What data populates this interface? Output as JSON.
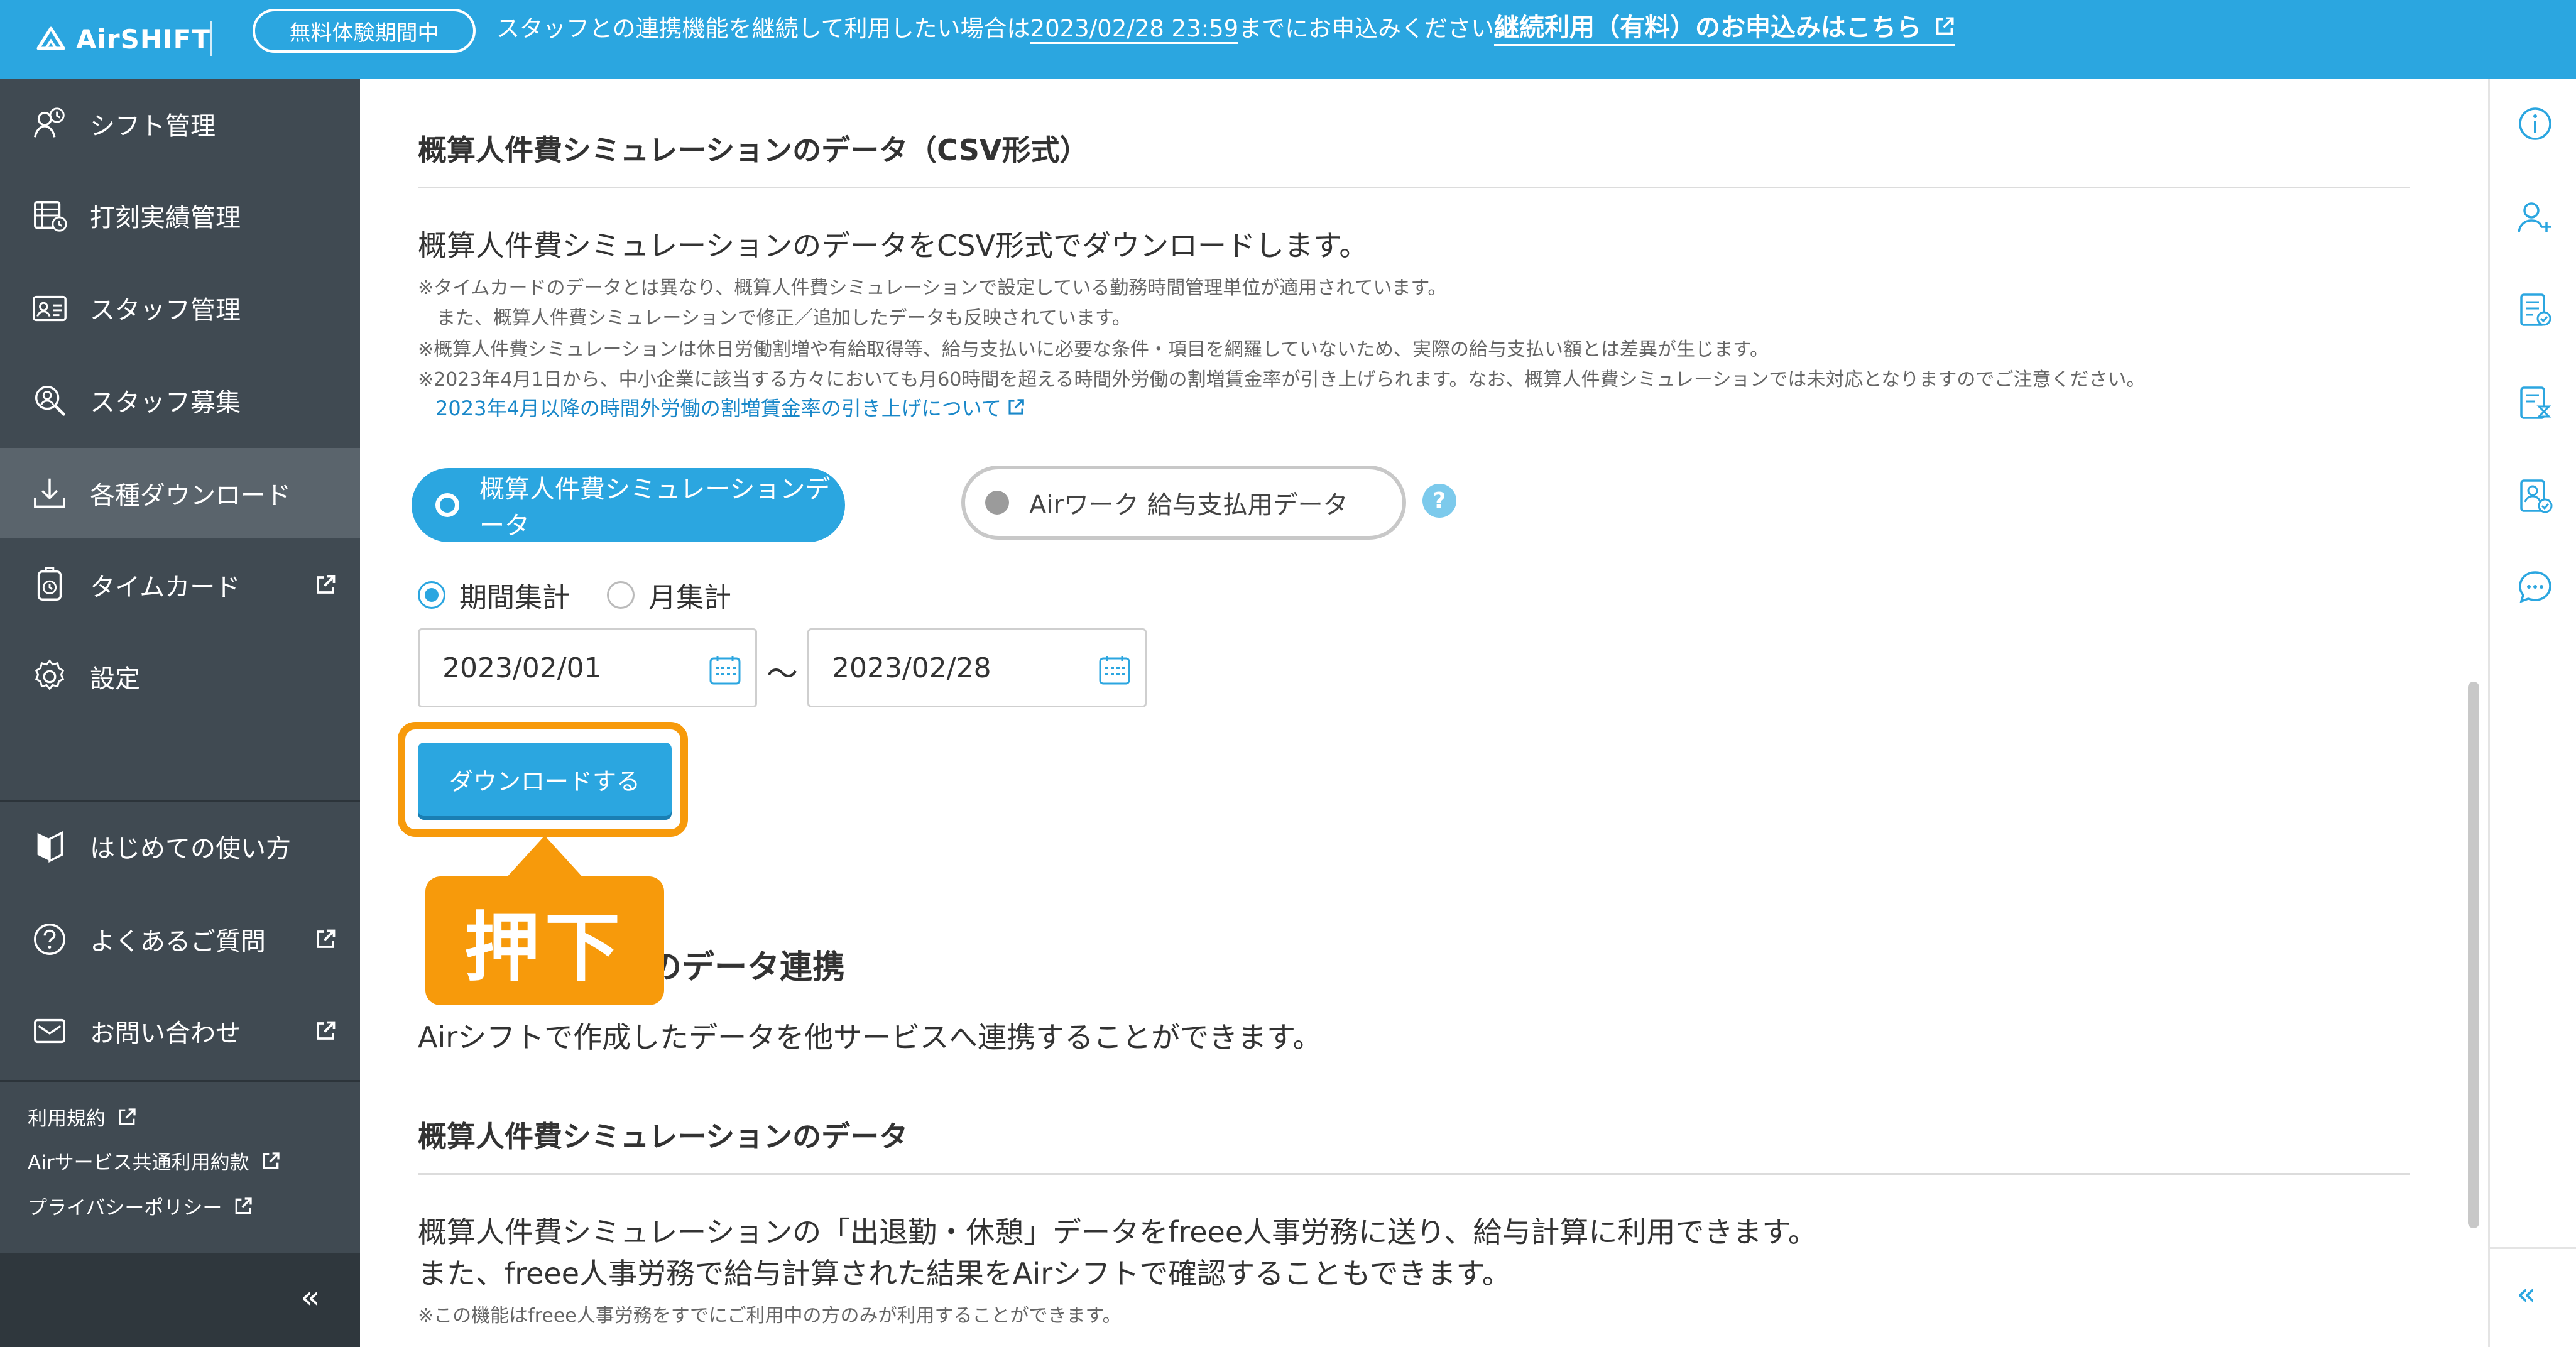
{
  "banner": {
    "logo_text": "AirSHIFT",
    "trial_badge": "無料体験期間中",
    "message_prefix": "スタッフとの連携機能を継続して利用したい場合は",
    "deadline": "2023/02/28 23:59",
    "message_suffix": "までにお申込みください。",
    "link": "継続利用（有料）のお申込みはこちら"
  },
  "sidebar": {
    "items": [
      {
        "label": "シフト管理",
        "icon": "shift-icon"
      },
      {
        "label": "打刻実績管理",
        "icon": "timesheet-icon"
      },
      {
        "label": "スタッフ管理",
        "icon": "staff-card-icon"
      },
      {
        "label": "スタッフ募集",
        "icon": "recruit-icon"
      },
      {
        "label": "各種ダウンロード",
        "icon": "download-icon",
        "active": true
      },
      {
        "label": "タイムカード",
        "icon": "timecard-icon",
        "external": true
      },
      {
        "label": "設定",
        "icon": "gear-icon"
      },
      {
        "label": "はじめての使い方",
        "icon": "beginner-icon"
      },
      {
        "label": "よくあるご質問",
        "icon": "question-icon",
        "external": true
      },
      {
        "label": "お問い合わせ",
        "icon": "mail-icon",
        "external": true
      }
    ],
    "legal_links": [
      "利用規約",
      "Airサービス共通利用約款",
      "プライバシーポリシー"
    ],
    "collapse": "«"
  },
  "main": {
    "csv_section_title": "概算人件費シミュレーションのデータ（CSV形式）",
    "csv_description": "概算人件費シミュレーションのデータをCSV形式でダウンロードします。",
    "notes": [
      "※タイムカードのデータとは異なり、概算人件費シミュレーションで設定している勤務時間管理単位が適用されています。",
      "　また、概算人件費シミュレーションで修正／追加したデータも反映されています。",
      "※概算人件費シミュレーションは休日労働割増や有給取得等、給与支払いに必要な条件・項目を網羅していないため、実際の給与支払い額とは差異が生じます。",
      "※2023年4月1日から、中小企業に該当する方々においても月60時間を超える時間外労働の割増賃金率が引き上げられます。なお、概算人件費シミュレーションでは未対応となりますのでご注意ください。"
    ],
    "note_link": "2023年4月以降の時間外労働の割増賃金率の引き上げについて",
    "toggle_options": [
      "概算人件費シミュレーションデータ",
      "Airワーク 給与支払用データ"
    ],
    "toggle_selected": "概算人件費シミュレーションデータ",
    "radio_options": [
      "期間集計",
      "月集計"
    ],
    "radio_selected": "期間集計",
    "date_from": "2023/02/01",
    "date_separator": "〜",
    "date_to": "2023/02/28",
    "download_button": "ダウンロードする",
    "callout": "押下",
    "linkage_title_visible": "のデータ連携",
    "linkage_description": "Airシフトで作成したデータを他サービスへ連携することができます。",
    "sim_section_title": "概算人件費シミュレーションのデータ",
    "sim_description_1": "概算人件費シミュレーションの「出退勤・休憩」データをfreee人事労務に送り、給与計算に利用できます。",
    "sim_description_2": "また、freee人事労務で給与計算された結果をAirシフトで確認することもできます。",
    "sim_note": "※この機能はfreee人事労務をすでにご利用中の方のみが利用することができます。"
  },
  "right_rail": {
    "icons": [
      "info-icon",
      "add-user-icon",
      "checklist-icon",
      "hourglass-doc-icon",
      "user-check-icon",
      "chat-icon"
    ],
    "collapse": "«"
  },
  "colors": {
    "brand": "#2ba6e0",
    "sidebar": "#404a52",
    "highlight": "#f79a0b"
  }
}
